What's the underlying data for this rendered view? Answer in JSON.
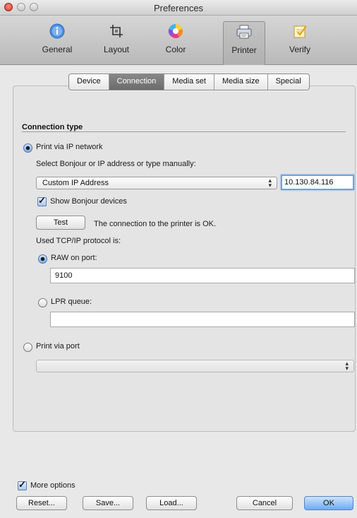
{
  "window": {
    "title": "Preferences"
  },
  "toolbar": {
    "items": [
      {
        "label": "General",
        "icon": "info-icon"
      },
      {
        "label": "Layout",
        "icon": "crop-icon"
      },
      {
        "label": "Color",
        "icon": "color-wheel-icon"
      },
      {
        "label": "Printer",
        "icon": "printer-icon",
        "selected": true
      },
      {
        "label": "Verify",
        "icon": "verify-icon"
      }
    ]
  },
  "tabs": [
    {
      "label": "Device"
    },
    {
      "label": "Connection",
      "active": true
    },
    {
      "label": "Media set"
    },
    {
      "label": "Media size"
    },
    {
      "label": "Special"
    }
  ],
  "connection": {
    "section_title": "Connection type",
    "ip_radio_label": "Print via IP network",
    "ip_radio_selected": true,
    "bonjour_prompt": "Select Bonjour or IP address or type manually:",
    "address_select_value": "Custom IP Address",
    "ip_address_value": "10.130.84.116",
    "show_bonjour_label": "Show Bonjour devices",
    "show_bonjour_checked": true,
    "test_button_label": "Test",
    "test_status": "The connection to the printer is OK.",
    "protocol_label": "Used TCP/IP protocol is:",
    "raw_label": "RAW on port:",
    "raw_selected": true,
    "raw_port_value": "9100",
    "lpr_label": "LPR queue:",
    "lpr_selected": false,
    "lpr_queue_value": "",
    "port_radio_label": "Print via port",
    "port_radio_selected": false,
    "port_select_value": ""
  },
  "footer": {
    "more_options_label": "More options",
    "more_options_checked": true,
    "reset_label": "Reset...",
    "save_label": "Save...",
    "load_label": "Load...",
    "cancel_label": "Cancel",
    "ok_label": "OK"
  },
  "colors": {
    "accent": "#6eaaee",
    "selected_segment": "#6b6b6b",
    "close_button": "#d63a2f"
  }
}
